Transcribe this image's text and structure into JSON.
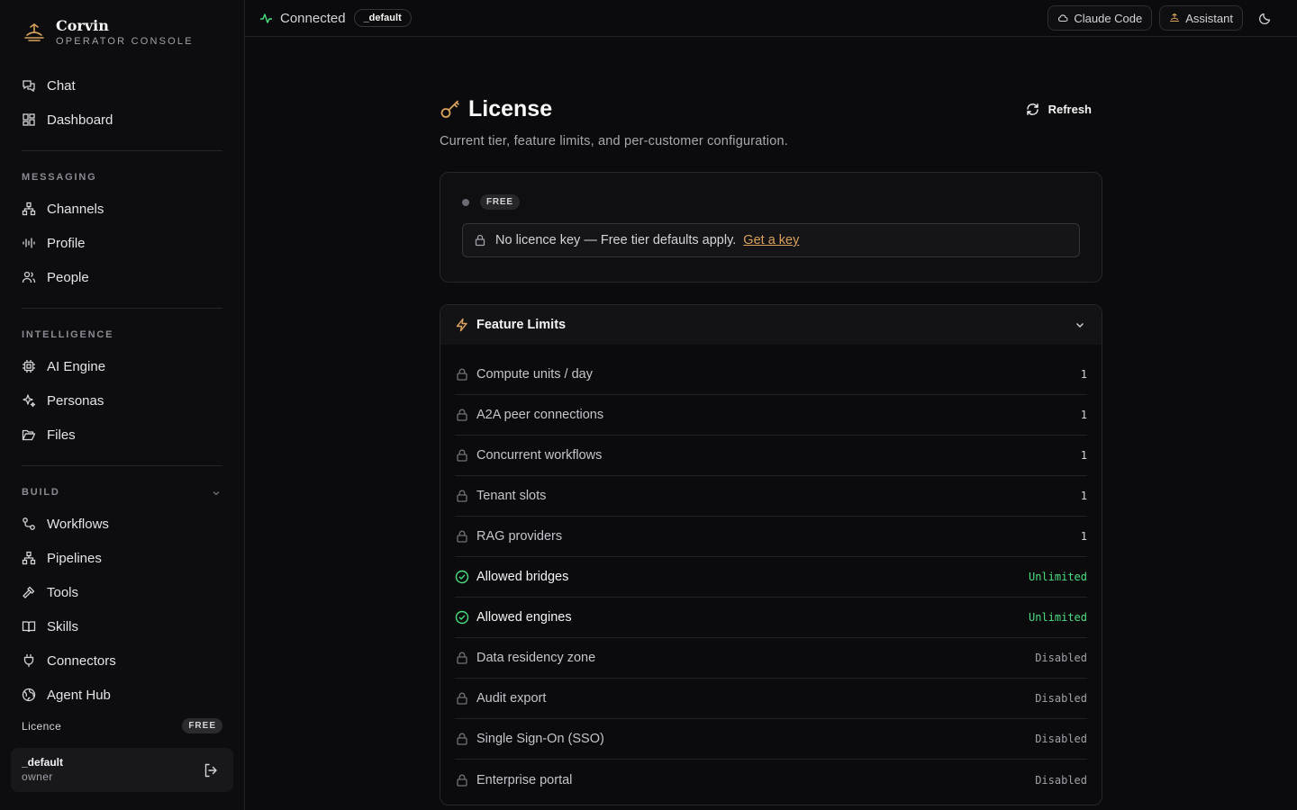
{
  "brand": {
    "name": "Corvin",
    "subtitle": "OPERATOR CONSOLE"
  },
  "sidebar": {
    "top_items": [
      {
        "label": "Chat",
        "icon": "chat-icon"
      },
      {
        "label": "Dashboard",
        "icon": "dashboard-icon"
      }
    ],
    "sections": [
      {
        "title": "MESSAGING",
        "items": [
          {
            "label": "Channels",
            "icon": "channels-icon"
          },
          {
            "label": "Profile",
            "icon": "audio-wave-icon"
          },
          {
            "label": "People",
            "icon": "people-icon"
          }
        ]
      },
      {
        "title": "INTELLIGENCE",
        "items": [
          {
            "label": "AI Engine",
            "icon": "cpu-icon"
          },
          {
            "label": "Personas",
            "icon": "sparkles-icon"
          },
          {
            "label": "Files",
            "icon": "folder-icon"
          }
        ]
      },
      {
        "title": "BUILD",
        "items": [
          {
            "label": "Workflows",
            "icon": "workflow-icon"
          },
          {
            "label": "Pipelines",
            "icon": "pipeline-icon"
          },
          {
            "label": "Tools",
            "icon": "hammer-icon"
          },
          {
            "label": "Skills",
            "icon": "book-icon"
          },
          {
            "label": "Connectors",
            "icon": "plug-icon"
          },
          {
            "label": "Agent Hub",
            "icon": "globe-icon"
          }
        ]
      }
    ],
    "licence_label": "Licence",
    "licence_tier": "FREE",
    "user": {
      "name": "_default",
      "role": "owner"
    }
  },
  "topbar": {
    "status": "Connected",
    "tenant": "_default",
    "claude_code_label": "Claude Code",
    "assistant_label": "Assistant"
  },
  "page": {
    "title": "License",
    "subtitle": "Current tier, feature limits, and per-customer configuration.",
    "refresh_label": "Refresh",
    "tier_badge": "FREE",
    "notice_text": "No licence key — Free tier defaults apply.",
    "notice_link": "Get a key"
  },
  "limits": {
    "title": "Feature Limits",
    "rows": [
      {
        "name": "Compute units / day",
        "value": "1",
        "state": "locked"
      },
      {
        "name": "A2A peer connections",
        "value": "1",
        "state": "locked"
      },
      {
        "name": "Concurrent workflows",
        "value": "1",
        "state": "locked"
      },
      {
        "name": "Tenant slots",
        "value": "1",
        "state": "locked"
      },
      {
        "name": "RAG providers",
        "value": "1",
        "state": "locked"
      },
      {
        "name": "Allowed bridges",
        "value": "Unlimited",
        "state": "unlimited"
      },
      {
        "name": "Allowed engines",
        "value": "Unlimited",
        "state": "unlimited"
      },
      {
        "name": "Data residency zone",
        "value": "Disabled",
        "state": "disabled"
      },
      {
        "name": "Audit export",
        "value": "Disabled",
        "state": "disabled"
      },
      {
        "name": "Single Sign-On (SSO)",
        "value": "Disabled",
        "state": "disabled"
      },
      {
        "name": "Enterprise portal",
        "value": "Disabled",
        "state": "disabled"
      }
    ]
  },
  "colors": {
    "accent": "#d9a15c",
    "success": "#4ade80",
    "background": "#0b0b0d"
  }
}
